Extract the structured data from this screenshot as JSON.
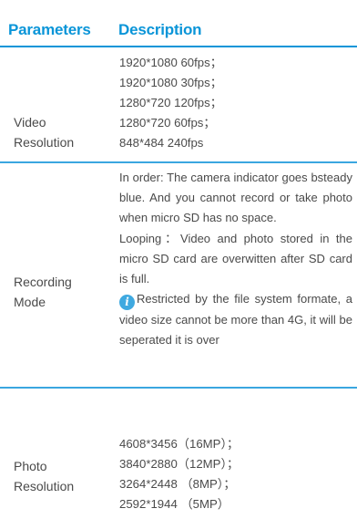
{
  "header": {
    "parameters": "Parameters",
    "description": "Description"
  },
  "rows": [
    {
      "label_lines": [
        "Video",
        "Resolution"
      ],
      "values": [
        "1920*1080  60fps；",
        "1920*1080  30fps；",
        "1280*720  120fps；",
        "1280*720    60fps；",
        "848*484    240fps"
      ]
    },
    {
      "label_lines": [
        "Recording",
        "Mode"
      ],
      "paragraph1": "In order: The camera indicator goes bsteady blue. And you cannot record or take photo when micro SD has no space.",
      "paragraph2": "Looping：Video and photo stored in the micro SD card are overwitten after SD card is full.",
      "note_icon": "info-icon",
      "note": "Restricted by the file system formate, a video size cannot be more than 4G, it will be seperated it is over"
    },
    {
      "label_lines": [
        "Photo",
        "Resolution"
      ],
      "values": [
        "4608*3456（16MP）；",
        "3840*2880（12MP）；",
        "3264*2448  （8MP）；",
        "2592*1944  （5MP）"
      ]
    }
  ],
  "colors": {
    "accent": "#0a95d8",
    "text": "#4a4a4a",
    "icon": "#3fa9e0"
  }
}
